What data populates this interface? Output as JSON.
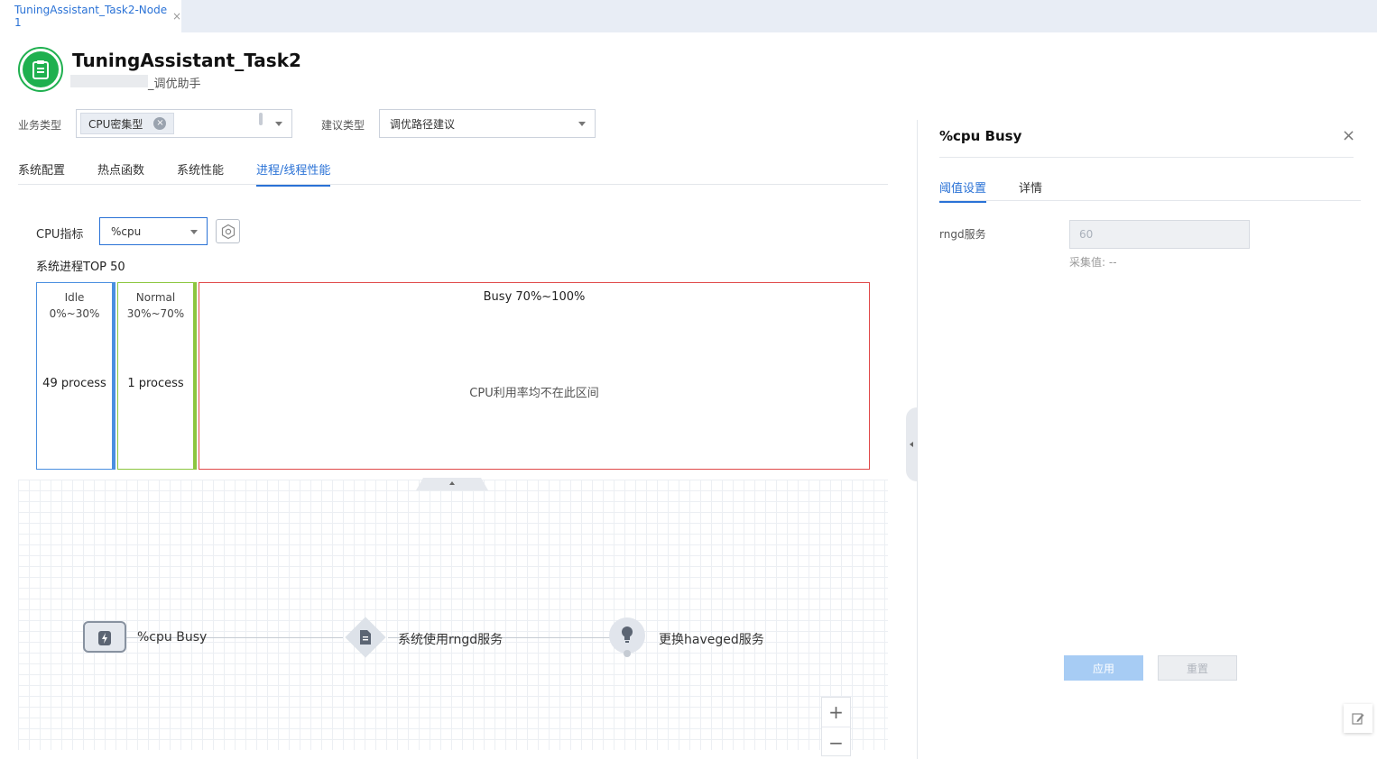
{
  "tab": {
    "label": "TuningAssistant_Task2-Node 1",
    "close": "×"
  },
  "header": {
    "title": "TuningAssistant_Task2",
    "subtitle": "_调优助手"
  },
  "filters": {
    "business_type_label": "业务类型",
    "business_type_chip": "CPU密集型",
    "chip_remove": "×",
    "suggestion_type_label": "建议类型",
    "suggestion_type_value": "调优路径建议"
  },
  "tabs": [
    "系统配置",
    "热点函数",
    "系统性能",
    "进程/线程性能"
  ],
  "active_tab": "进程/线程性能",
  "metric": {
    "label": "CPU指标",
    "value": "%cpu"
  },
  "top_label": "系统进程TOP 50",
  "buckets": {
    "idle": {
      "name": "Idle",
      "range": "0%~30%",
      "count": "49 process",
      "color": "#4a8fe0"
    },
    "normal": {
      "name": "Normal",
      "range": "30%~70%",
      "count": "1 process",
      "color": "#8cc63f"
    },
    "busy": {
      "name": "Busy 70%~100%",
      "message": "CPU利用率均不在此区间",
      "color": "#e04a4a"
    }
  },
  "flow": {
    "node1": {
      "label": "%cpu Busy",
      "icon": "alert-battery-icon"
    },
    "node2": {
      "label": "系统使用rngd服务",
      "icon": "document-icon"
    },
    "node3": {
      "label": "更换haveged服务",
      "icon": "lightbulb-icon"
    }
  },
  "zoom": {
    "in": "+",
    "out": "−"
  },
  "panel": {
    "title": "%cpu Busy",
    "close": "×",
    "tabs": [
      "阈值设置",
      "详情"
    ],
    "active_tab": "阈值设置",
    "field_label": "rngd服务",
    "field_value": "60",
    "collected": "采集值: --",
    "apply": "应用",
    "reset": "重置"
  },
  "colors": {
    "accent": "#2a72d6",
    "brand_green": "#1fb04f"
  }
}
